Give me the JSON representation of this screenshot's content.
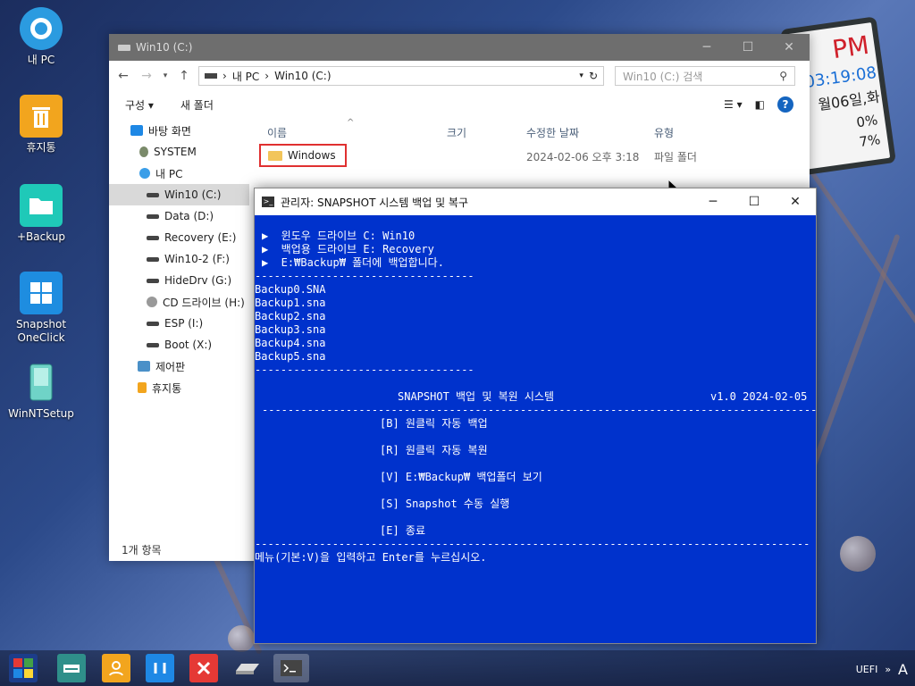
{
  "desktop": {
    "icons": [
      {
        "label": "내 PC"
      },
      {
        "label": "휴지통"
      },
      {
        "label": "+Backup"
      },
      {
        "label": "Snapshot\nOneClick"
      },
      {
        "label": "WinNTSetup"
      }
    ]
  },
  "clock": {
    "ampm": "PM",
    "time": "03:19:08",
    "date": "월06일,화",
    "stat1": "0%",
    "stat2": "7%"
  },
  "explorer": {
    "title": "Win10 (C:)",
    "breadcrumb": [
      "내 PC",
      "Win10 (C:)"
    ],
    "search_placeholder": "Win10 (C:) 검색",
    "commands": {
      "organize": "구성 ▾",
      "new_folder": "새 폴더"
    },
    "nav_items": [
      {
        "label": "바탕 화면"
      },
      {
        "label": "SYSTEM"
      },
      {
        "label": "내 PC"
      },
      {
        "label": "Win10 (C:)"
      },
      {
        "label": "Data (D:)"
      },
      {
        "label": "Recovery (E:)"
      },
      {
        "label": "Win10-2 (F:)"
      },
      {
        "label": "HideDrv (G:)"
      },
      {
        "label": "CD 드라이브 (H:)"
      },
      {
        "label": "ESP (I:)"
      },
      {
        "label": "Boot (X:)"
      },
      {
        "label": "제어판"
      },
      {
        "label": "휴지통"
      }
    ],
    "columns": {
      "name": "이름",
      "size": "크기",
      "modified": "수정한 날짜",
      "type": "유형"
    },
    "files": [
      {
        "name": "Windows",
        "modified": "2024-02-06 오후 3:18",
        "type": "파일 폴더"
      }
    ],
    "status": "1개 항목"
  },
  "console": {
    "title": "관리자:  SNAPSHOT 시스템 백업 및 복구",
    "lines": {
      "info1": "▶  윈도우 드라이브 C: Win10",
      "info2": "▶  백업용 드라이브 E: Recovery",
      "info3": "▶  E:₩Backup₩ 폴더에 백업합니다.",
      "sep_short": "----------------------------------",
      "files": [
        "Backup0.SNA",
        "Backup1.sna",
        "Backup2.sna",
        "Backup3.sna",
        "Backup4.sna",
        "Backup5.sna"
      ],
      "header": "SNAPSHOT 백업 및 복원 시스템",
      "version": "v1.0 2024-02-05",
      "sep_long": "--------------------------------------------------------------------------------------",
      "menu": [
        "[B] 원클릭 자동 백업",
        "[R] 원클릭 자동 복원",
        "[V] E:₩Backup₩ 백업폴더 보기",
        "[S] Snapshot 수동 실행",
        "[E] 종료"
      ],
      "prompt": "메뉴(기본:V)을 입력하고 Enter를 누르십시오."
    }
  },
  "taskbar": {
    "tray": {
      "uefi": "UEFI",
      "chev": "»",
      "ime": "A"
    }
  }
}
